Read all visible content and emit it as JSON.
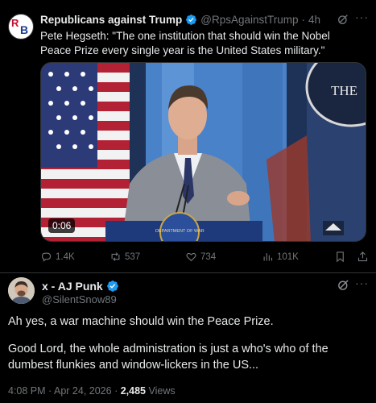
{
  "quoted_tweet": {
    "author_name": "Republicans against Trump",
    "author_handle": "@RpsAgainstTrump",
    "separator": "·",
    "time": "4h",
    "text": "Pete Hegseth: \"The one institution that should win the Nobel Peace Prize every single year is the United States military.\"",
    "video": {
      "timestamp": "0:06",
      "backdrop_text": "THE",
      "seal_text": "DEPARTMENT OF WAR"
    },
    "actions": {
      "replies": "1.4K",
      "reposts": "537",
      "likes": "734",
      "views": "101K"
    }
  },
  "tweet": {
    "author_name": "x - AJ Punk",
    "author_handle": "@SilentSnow89",
    "paragraphs": [
      "Ah yes, a war machine should win the Peace Prize.",
      "Good Lord, the whole administration is just a who's who of the dumbest flunkies and window-lickers in the US..."
    ],
    "time": "4:08 PM",
    "date": "Apr 24, 2026",
    "views_count": "2,485",
    "views_label": "Views"
  },
  "colors": {
    "background": "#000000",
    "text_primary": "#e7e9ea",
    "text_muted": "#71767b",
    "verified_blue": "#1d9bf0",
    "divider": "#2f3336"
  },
  "icons": [
    "reply-icon",
    "repost-icon",
    "like-icon",
    "views-icon",
    "bookmark-icon",
    "share-icon",
    "grok-icon",
    "more-icon",
    "verified-badge-icon"
  ]
}
